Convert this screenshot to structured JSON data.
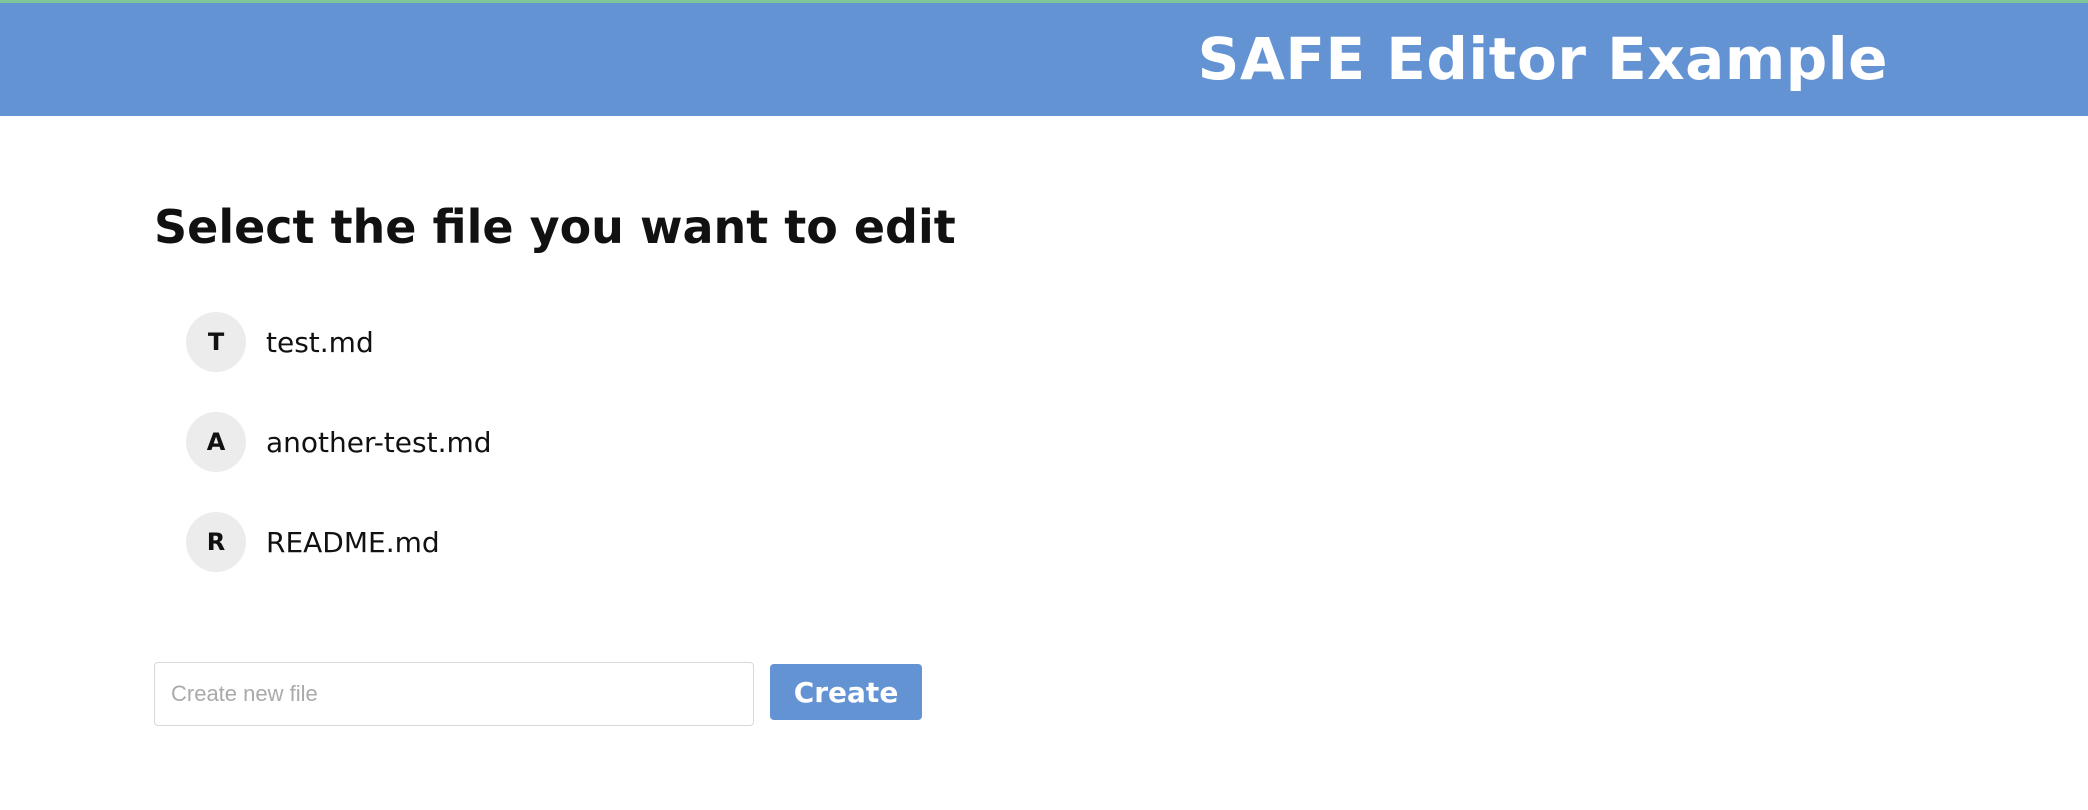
{
  "header": {
    "title": "SAFE Editor Example"
  },
  "main": {
    "heading": "Select the file you want to edit",
    "files": [
      {
        "initial": "T",
        "name": "test.md"
      },
      {
        "initial": "A",
        "name": "another-test.md"
      },
      {
        "initial": "R",
        "name": "README.md"
      }
    ],
    "new_file": {
      "placeholder": "Create new file",
      "value": ""
    },
    "create_label": "Create"
  },
  "colors": {
    "header_bg": "#6493d4",
    "header_top_border": "#7fc59a",
    "avatar_bg": "#ececec",
    "button_bg": "#6493d4"
  }
}
